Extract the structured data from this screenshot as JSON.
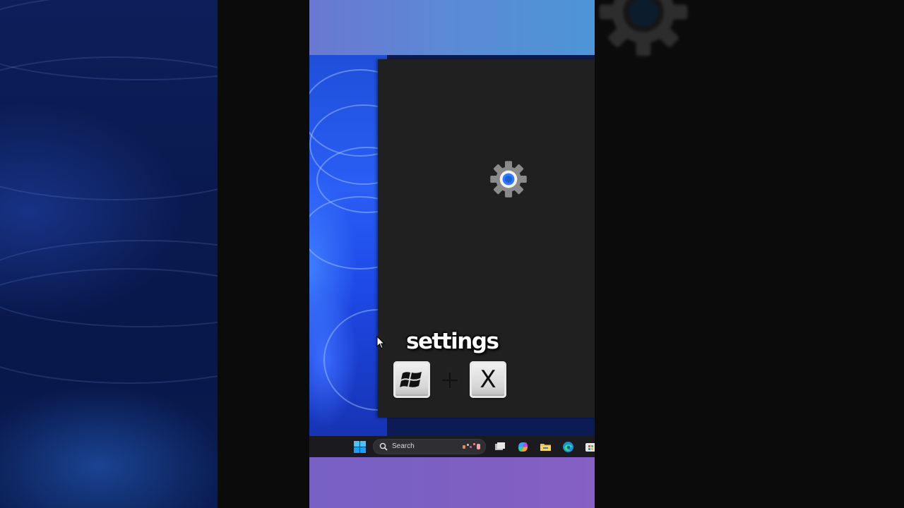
{
  "colors": {
    "popup_bg": "#202020",
    "accent_blue": "#2f7bff",
    "taskbar_bg": "#1b1b1f"
  },
  "popup": {
    "icon": "settings-gear-icon"
  },
  "overlay": {
    "caption": "settings",
    "shortcut": {
      "key1_icon": "windows-logo-icon",
      "plus": "+",
      "key2": "X"
    }
  },
  "taskbar": {
    "search_placeholder": "Search",
    "icons": [
      "windows-start-icon",
      "search-icon",
      "task-view-icon",
      "copilot-icon",
      "file-explorer-icon",
      "edge-icon",
      "store-icon"
    ]
  }
}
